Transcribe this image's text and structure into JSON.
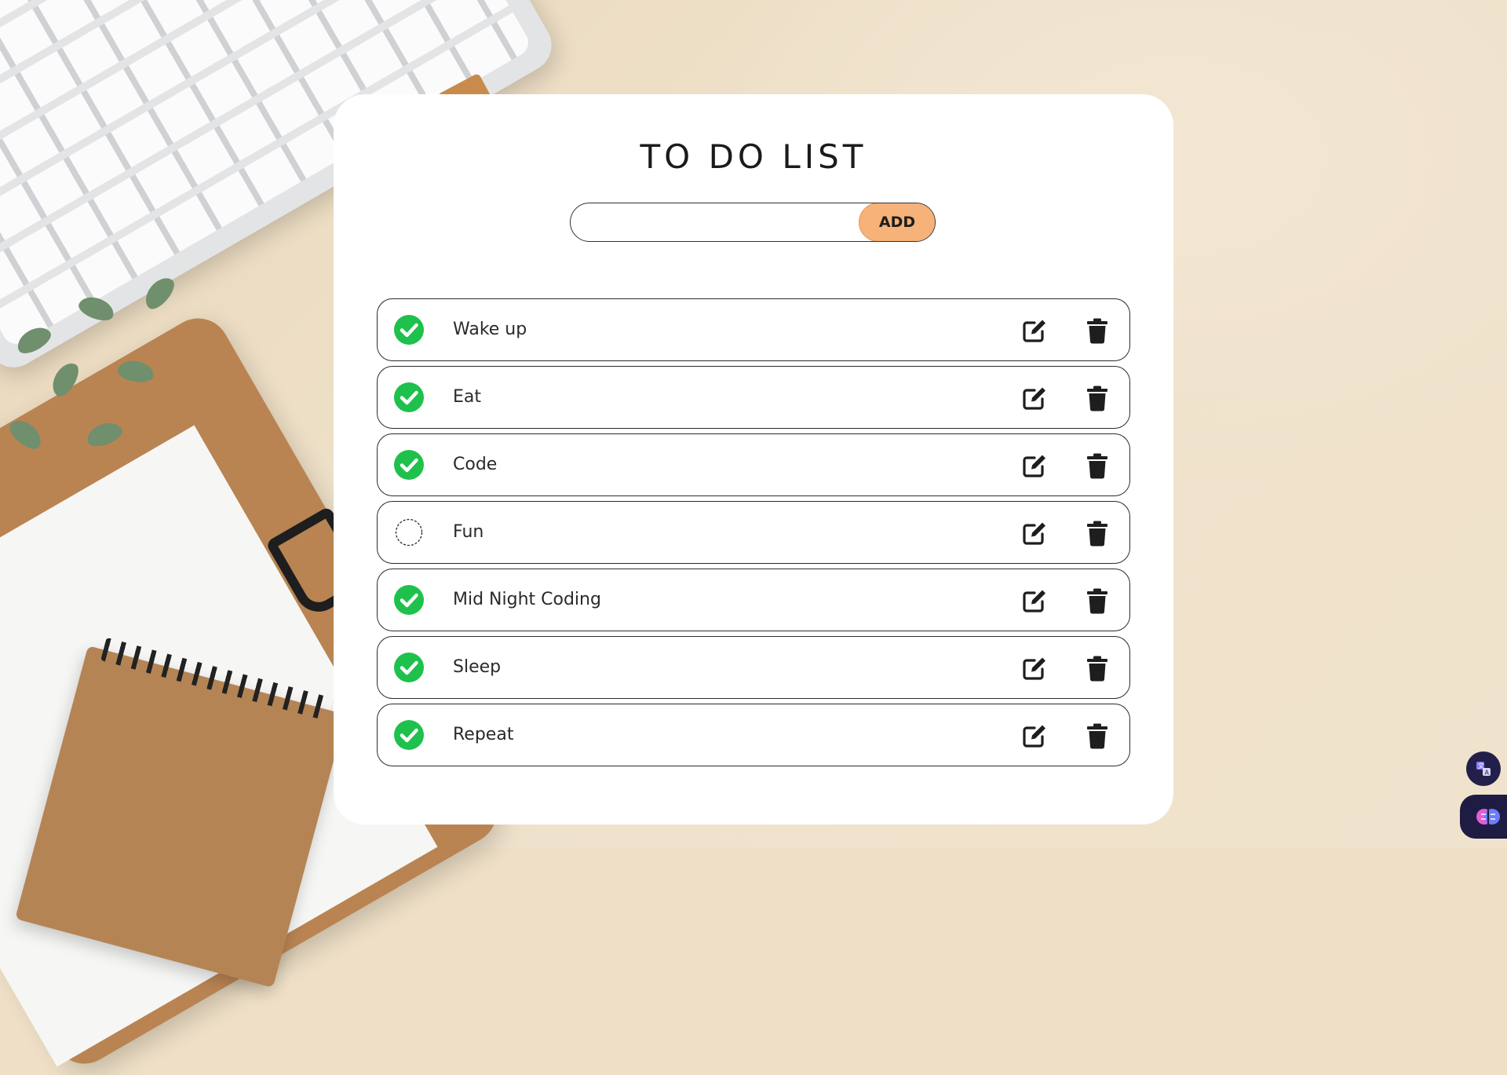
{
  "app": {
    "title": "TO DO LIST"
  },
  "add_form": {
    "input_value": "",
    "input_placeholder": "",
    "button_label": "ADD"
  },
  "tasks": [
    {
      "label": "Wake up",
      "done": true
    },
    {
      "label": "Eat",
      "done": true
    },
    {
      "label": "Code",
      "done": true
    },
    {
      "label": "Fun",
      "done": false
    },
    {
      "label": "Mid Night Coding",
      "done": true
    },
    {
      "label": "Sleep",
      "done": true
    },
    {
      "label": "Repeat",
      "done": true
    }
  ],
  "icons": {
    "done": "check-circle-icon",
    "not_done": "empty-circle-icon",
    "edit": "edit-icon",
    "delete": "trash-icon",
    "extension_translate": "translate-icon",
    "extension_ai": "brain-icon"
  },
  "colors": {
    "background": "#eedfc6",
    "card": "#ffffff",
    "add_button": "#f6b278",
    "check_green": "#1ec14b",
    "text": "#1b1b1b"
  }
}
